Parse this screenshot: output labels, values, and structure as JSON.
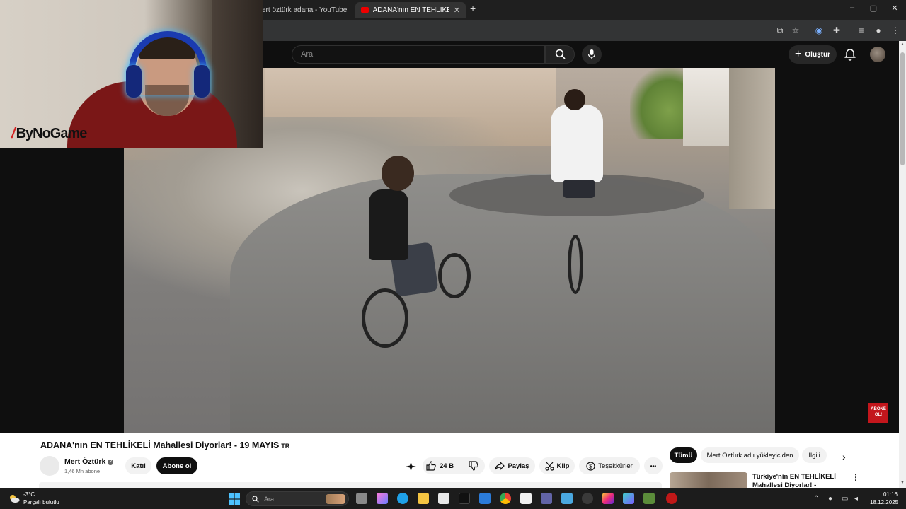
{
  "browser": {
    "tabs": [
      {
        "label": "ert öztürk adana - YouTube",
        "active": false
      },
      {
        "label": "ADANA'nın EN TEHLİKELİ Mahalle",
        "active": true
      }
    ],
    "new_tab": "+",
    "window_controls": {
      "minimize": "–",
      "maximize": "▢",
      "close": "✕"
    }
  },
  "youtube": {
    "search": {
      "placeholder": "Ara"
    },
    "create_label": "Oluştur",
    "create_icon": "+"
  },
  "overlay": {
    "logo_text": "ByNoGame",
    "logo_mark": "/"
  },
  "abone_badge": {
    "line1": "ABONE",
    "line2": "OL!"
  },
  "video": {
    "title": "ADANA'nın EN TEHLİKELİ Mahallesi Diyorlar! - 19 MAYIS",
    "title_badge": "TR",
    "channel": {
      "name": "Mert Öztürk",
      "verified": "✓",
      "subscribers": "1,46 Mn abone",
      "join_label": "Katıl",
      "subscribe_label": "Abone ol"
    },
    "actions": {
      "likes": "24 B",
      "share": "Paylaş",
      "clip": "Klip",
      "thanks": "Teşekkürler",
      "more": "•••"
    }
  },
  "related": {
    "chips": [
      "Tümü",
      "Mert Öztürk adlı yükleyiciden",
      "İlgili"
    ],
    "next": "›",
    "first_title": "Türkiye'nin EN TEHLİKELİ Mahallesi Diyorlar! - HÜRRİYE...",
    "more": "⋮"
  },
  "taskbar": {
    "weather_temp": "-3°C",
    "weather_desc": "Parçalı bulutlu",
    "search_placeholder": "Ara",
    "time": "01:16",
    "date": "18.12.2025"
  },
  "colors": {
    "youtube_red": "#ff0000",
    "page_dark": "#0f0f0f",
    "subscribe_bg": "#0f0f0f",
    "abone_badge": "#c3161c",
    "headset_glow": "#3fb4ff"
  }
}
